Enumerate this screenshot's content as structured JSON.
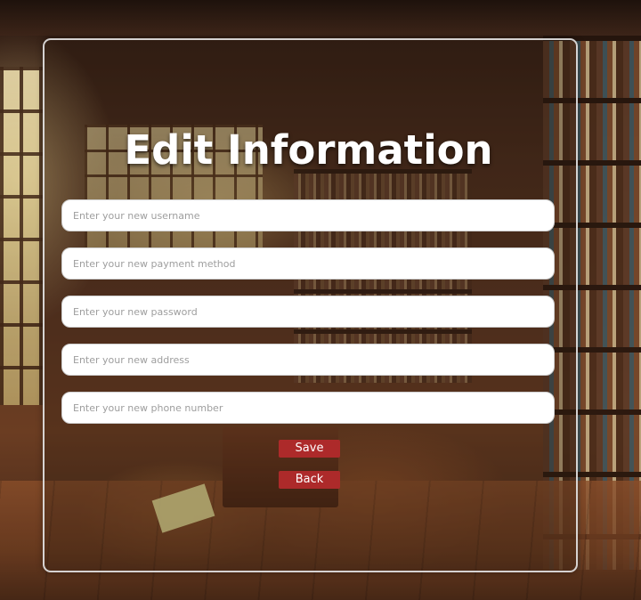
{
  "page": {
    "title": "Edit Information"
  },
  "form": {
    "username": {
      "value": "",
      "placeholder": "Enter your new username"
    },
    "payment_method": {
      "value": "",
      "placeholder": "Enter your new payment method"
    },
    "password": {
      "value": "",
      "placeholder": "Enter your new password"
    },
    "address": {
      "value": "",
      "placeholder": "Enter your new address"
    },
    "phone_number": {
      "value": "",
      "placeholder": "Enter your new phone number"
    }
  },
  "actions": {
    "save_label": "Save",
    "back_label": "Back"
  },
  "colors": {
    "button_bg": "#ad2a2a",
    "button_text": "#ffffff",
    "title_text": "#ffffff",
    "input_bg": "#ffffff",
    "card_border": "#e6e6e6"
  }
}
